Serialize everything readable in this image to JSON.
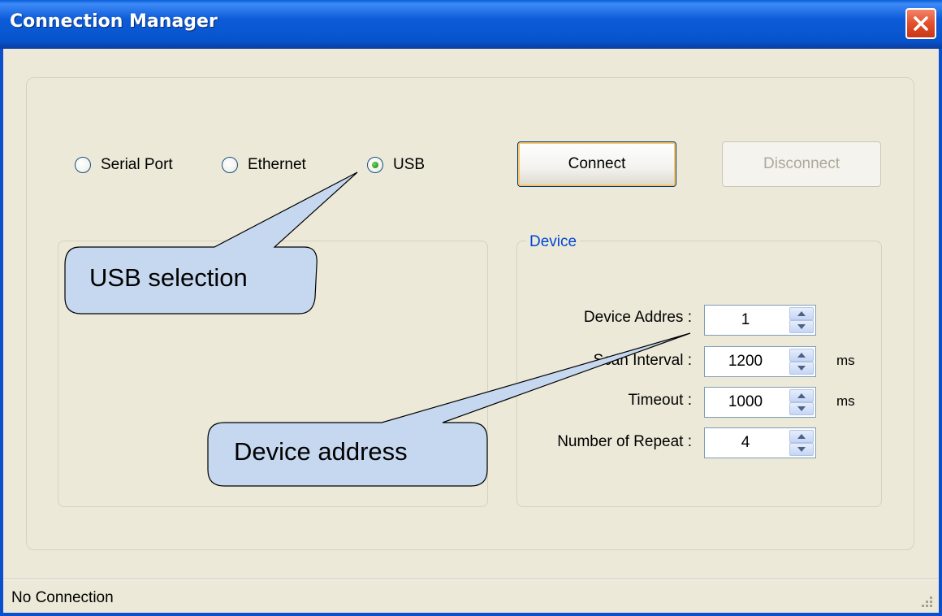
{
  "window": {
    "title": "Connection Manager",
    "close_icon": "close-icon",
    "accent_color": "#0a5fd9",
    "close_color": "#e3502c"
  },
  "connection_type": {
    "options": [
      {
        "label": "Serial Port",
        "selected": false
      },
      {
        "label": "Ethernet",
        "selected": false
      },
      {
        "label": "USB",
        "selected": true
      }
    ]
  },
  "actions": {
    "connect_label": "Connect",
    "disconnect_label": "Disconnect",
    "disconnect_enabled": false
  },
  "device": {
    "group_label": "Device",
    "fields": [
      {
        "label": "Device Addres :",
        "value": "1",
        "unit": ""
      },
      {
        "label": "Scan Interval :",
        "value": "1200",
        "unit": "ms"
      },
      {
        "label": "Timeout :",
        "value": "1000",
        "unit": "ms"
      },
      {
        "label": "Number of Repeat :",
        "value": "4",
        "unit": ""
      }
    ],
    "legend_color": "#0046d5"
  },
  "callouts": [
    {
      "text": "USB selection"
    },
    {
      "text": "Device address"
    }
  ],
  "callout_fill": "#c6d8f0",
  "status": {
    "text": "No Connection"
  }
}
